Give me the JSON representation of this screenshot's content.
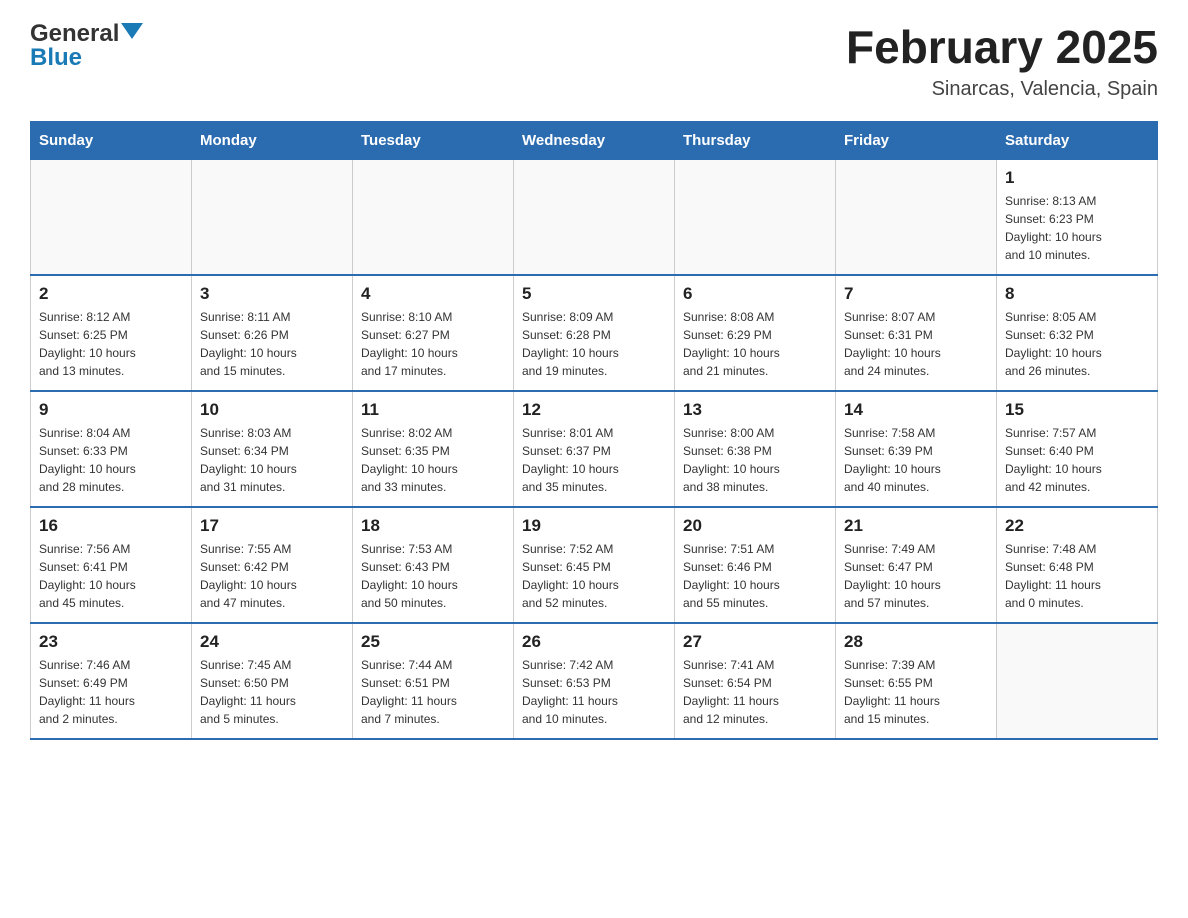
{
  "header": {
    "logo_general": "General",
    "logo_blue": "Blue",
    "month_title": "February 2025",
    "subtitle": "Sinarcas, Valencia, Spain"
  },
  "weekdays": [
    "Sunday",
    "Monday",
    "Tuesday",
    "Wednesday",
    "Thursday",
    "Friday",
    "Saturday"
  ],
  "weeks": [
    {
      "days": [
        {
          "num": "",
          "info": ""
        },
        {
          "num": "",
          "info": ""
        },
        {
          "num": "",
          "info": ""
        },
        {
          "num": "",
          "info": ""
        },
        {
          "num": "",
          "info": ""
        },
        {
          "num": "",
          "info": ""
        },
        {
          "num": "1",
          "info": "Sunrise: 8:13 AM\nSunset: 6:23 PM\nDaylight: 10 hours\nand 10 minutes."
        }
      ]
    },
    {
      "days": [
        {
          "num": "2",
          "info": "Sunrise: 8:12 AM\nSunset: 6:25 PM\nDaylight: 10 hours\nand 13 minutes."
        },
        {
          "num": "3",
          "info": "Sunrise: 8:11 AM\nSunset: 6:26 PM\nDaylight: 10 hours\nand 15 minutes."
        },
        {
          "num": "4",
          "info": "Sunrise: 8:10 AM\nSunset: 6:27 PM\nDaylight: 10 hours\nand 17 minutes."
        },
        {
          "num": "5",
          "info": "Sunrise: 8:09 AM\nSunset: 6:28 PM\nDaylight: 10 hours\nand 19 minutes."
        },
        {
          "num": "6",
          "info": "Sunrise: 8:08 AM\nSunset: 6:29 PM\nDaylight: 10 hours\nand 21 minutes."
        },
        {
          "num": "7",
          "info": "Sunrise: 8:07 AM\nSunset: 6:31 PM\nDaylight: 10 hours\nand 24 minutes."
        },
        {
          "num": "8",
          "info": "Sunrise: 8:05 AM\nSunset: 6:32 PM\nDaylight: 10 hours\nand 26 minutes."
        }
      ]
    },
    {
      "days": [
        {
          "num": "9",
          "info": "Sunrise: 8:04 AM\nSunset: 6:33 PM\nDaylight: 10 hours\nand 28 minutes."
        },
        {
          "num": "10",
          "info": "Sunrise: 8:03 AM\nSunset: 6:34 PM\nDaylight: 10 hours\nand 31 minutes."
        },
        {
          "num": "11",
          "info": "Sunrise: 8:02 AM\nSunset: 6:35 PM\nDaylight: 10 hours\nand 33 minutes."
        },
        {
          "num": "12",
          "info": "Sunrise: 8:01 AM\nSunset: 6:37 PM\nDaylight: 10 hours\nand 35 minutes."
        },
        {
          "num": "13",
          "info": "Sunrise: 8:00 AM\nSunset: 6:38 PM\nDaylight: 10 hours\nand 38 minutes."
        },
        {
          "num": "14",
          "info": "Sunrise: 7:58 AM\nSunset: 6:39 PM\nDaylight: 10 hours\nand 40 minutes."
        },
        {
          "num": "15",
          "info": "Sunrise: 7:57 AM\nSunset: 6:40 PM\nDaylight: 10 hours\nand 42 minutes."
        }
      ]
    },
    {
      "days": [
        {
          "num": "16",
          "info": "Sunrise: 7:56 AM\nSunset: 6:41 PM\nDaylight: 10 hours\nand 45 minutes."
        },
        {
          "num": "17",
          "info": "Sunrise: 7:55 AM\nSunset: 6:42 PM\nDaylight: 10 hours\nand 47 minutes."
        },
        {
          "num": "18",
          "info": "Sunrise: 7:53 AM\nSunset: 6:43 PM\nDaylight: 10 hours\nand 50 minutes."
        },
        {
          "num": "19",
          "info": "Sunrise: 7:52 AM\nSunset: 6:45 PM\nDaylight: 10 hours\nand 52 minutes."
        },
        {
          "num": "20",
          "info": "Sunrise: 7:51 AM\nSunset: 6:46 PM\nDaylight: 10 hours\nand 55 minutes."
        },
        {
          "num": "21",
          "info": "Sunrise: 7:49 AM\nSunset: 6:47 PM\nDaylight: 10 hours\nand 57 minutes."
        },
        {
          "num": "22",
          "info": "Sunrise: 7:48 AM\nSunset: 6:48 PM\nDaylight: 11 hours\nand 0 minutes."
        }
      ]
    },
    {
      "days": [
        {
          "num": "23",
          "info": "Sunrise: 7:46 AM\nSunset: 6:49 PM\nDaylight: 11 hours\nand 2 minutes."
        },
        {
          "num": "24",
          "info": "Sunrise: 7:45 AM\nSunset: 6:50 PM\nDaylight: 11 hours\nand 5 minutes."
        },
        {
          "num": "25",
          "info": "Sunrise: 7:44 AM\nSunset: 6:51 PM\nDaylight: 11 hours\nand 7 minutes."
        },
        {
          "num": "26",
          "info": "Sunrise: 7:42 AM\nSunset: 6:53 PM\nDaylight: 11 hours\nand 10 minutes."
        },
        {
          "num": "27",
          "info": "Sunrise: 7:41 AM\nSunset: 6:54 PM\nDaylight: 11 hours\nand 12 minutes."
        },
        {
          "num": "28",
          "info": "Sunrise: 7:39 AM\nSunset: 6:55 PM\nDaylight: 11 hours\nand 15 minutes."
        },
        {
          "num": "",
          "info": ""
        }
      ]
    }
  ]
}
